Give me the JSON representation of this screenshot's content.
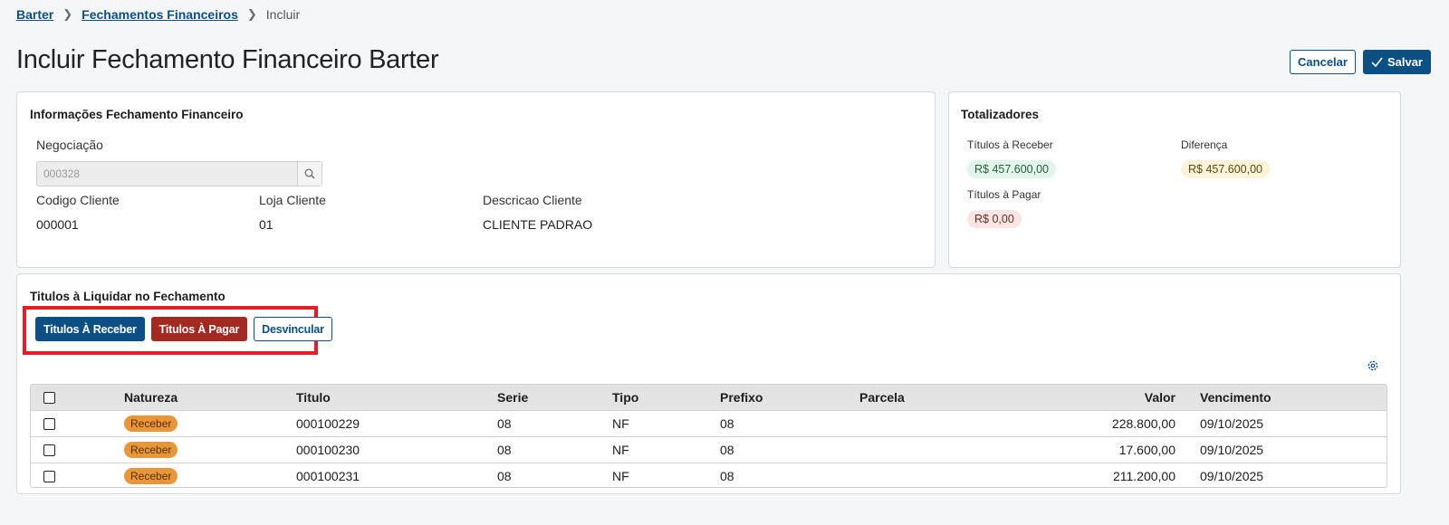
{
  "breadcrumb": {
    "items": [
      "Barter",
      "Fechamentos Financeiros"
    ],
    "current": "Incluir"
  },
  "page": {
    "title": "Incluir Fechamento Financeiro Barter"
  },
  "actions": {
    "cancel_label": "Cancelar",
    "save_label": "Salvar"
  },
  "info_card": {
    "title": "Informações Fechamento Financeiro",
    "negociacao_label": "Negociação",
    "negociacao_value": "000328",
    "codigo_cliente_label": "Codigo Cliente",
    "codigo_cliente_value": "000001",
    "loja_cliente_label": "Loja Cliente",
    "loja_cliente_value": "01",
    "descricao_cliente_label": "Descricao Cliente",
    "descricao_cliente_value": "CLIENTE PADRAO"
  },
  "totals_card": {
    "title": "Totalizadores",
    "receber_label": "Títulos à Receber",
    "receber_value": "R$ 457.600,00",
    "diferenca_label": "Diferença",
    "diferenca_value": "R$ 457.600,00",
    "pagar_label": "Títulos à Pagar",
    "pagar_value": "R$ 0,00"
  },
  "titles_card": {
    "title": "Titulos à Liquidar no Fechamento",
    "btn_receber": "Titulos À Receber",
    "btn_pagar": "Titulos À Pagar",
    "btn_desvincular": "Desvincular"
  },
  "table": {
    "columns": [
      "Natureza",
      "Titulo",
      "Serie",
      "Tipo",
      "Prefixo",
      "Parcela",
      "Valor",
      "Vencimento"
    ],
    "rows": [
      {
        "natureza": "Receber",
        "titulo": "000100229",
        "serie": "08",
        "tipo": "NF",
        "prefixo": "08",
        "parcela": "",
        "valor": "228.800,00",
        "vencimento": "09/10/2025"
      },
      {
        "natureza": "Receber",
        "titulo": "000100230",
        "serie": "08",
        "tipo": "NF",
        "prefixo": "08",
        "parcela": "",
        "valor": "17.600,00",
        "vencimento": "09/10/2025"
      },
      {
        "natureza": "Receber",
        "titulo": "000100231",
        "serie": "08",
        "tipo": "NF",
        "prefixo": "08",
        "parcela": "",
        "valor": "211.200,00",
        "vencimento": "09/10/2025"
      }
    ]
  },
  "colors": {
    "primary": "#0c4f82",
    "danger": "#a22a22",
    "highlight": "#e41e26",
    "tag_receber": "#e8963a"
  }
}
